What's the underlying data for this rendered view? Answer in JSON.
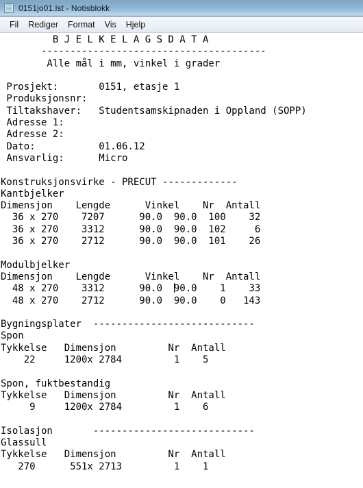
{
  "window": {
    "title": "0151jo01.lst - Notisblokk",
    "icon": "notepad-icon"
  },
  "menubar": {
    "items": [
      {
        "label": "Fil"
      },
      {
        "label": "Rediger"
      },
      {
        "label": "Format"
      },
      {
        "label": "Vis"
      },
      {
        "label": "Hjelp"
      }
    ]
  },
  "document": {
    "heading": "         B J E L K E L A G S D A T A",
    "heading_rule": "       ---------------------------------------",
    "subtitle": "        Alle mål i mm, vinkel i grader",
    "blank": "",
    "project": {
      "rows": [
        " Prosjekt:       0151, etasje 1",
        " Produksjonsnr:",
        " Tiltakshaver:   Studentsamskipnaden i Oppland (SOPP)",
        " Adresse 1:",
        " Adresse 2:",
        " Dato:           01.06.12",
        " Ansvarlig:      Micro"
      ]
    },
    "sections": {
      "precut": {
        "title": "Konstruksjonsvirke - PRECUT -------------",
        "sub1": {
          "name": "Kantbjelker",
          "header": "Dimensjon    Lengde      Vinkel    Nr  Antall",
          "rows": [
            "  36 x 270    7207      90.0  90.0  100    32",
            "  36 x 270    3312      90.0  90.0  102     6",
            "  36 x 270    2712      90.0  90.0  101    26"
          ]
        },
        "sub2": {
          "name": "Modulbjelker",
          "header": "Dimensjon    Lengde      Vinkel    Nr  Antall",
          "row1_before_caret": "  48 x 270    3312      90.0  ",
          "row1_after_caret": "90.0    1    33",
          "row2": "  48 x 270    2712      90.0  90.0    0   143"
        }
      },
      "bygningsplater": {
        "title": "Bygningsplater  ----------------------------",
        "sub1": {
          "name": "Spon",
          "header": "Tykkelse   Dimensjon         Nr  Antall",
          "rows": [
            "    22     1200x 2784         1    5"
          ]
        },
        "sub2": {
          "name": "Spon, fuktbestandig",
          "header": "Tykkelse   Dimensjon         Nr  Antall",
          "rows": [
            "     9     1200x 2784         1    6"
          ]
        }
      },
      "isolasjon": {
        "title": "Isolasjon       ----------------------------",
        "sub1": {
          "name": "Glassull",
          "header": "Tykkelse   Dimensjon         Nr  Antall",
          "rows": [
            "   270      551x 2713         1    1"
          ]
        }
      }
    }
  }
}
